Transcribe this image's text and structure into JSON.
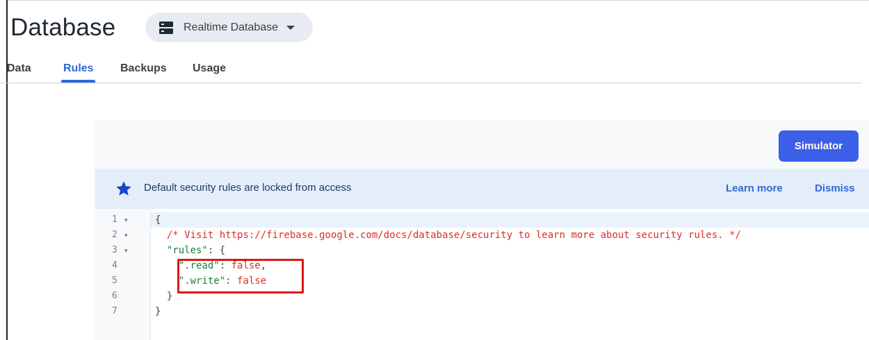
{
  "header": {
    "title": "Database",
    "db_selector": {
      "icon": "database-server-icon",
      "label": "Realtime Database"
    }
  },
  "tabs": [
    {
      "label": "Data",
      "active": false
    },
    {
      "label": "Rules",
      "active": true
    },
    {
      "label": "Backups",
      "active": false
    },
    {
      "label": "Usage",
      "active": false
    }
  ],
  "toolbar": {
    "simulator_label": "Simulator"
  },
  "banner": {
    "icon": "star-icon",
    "text": "Default security rules are locked from access",
    "learn_more_label": "Learn more",
    "dismiss_label": "Dismiss"
  },
  "editor": {
    "line_numbers": [
      "1",
      "2",
      "3",
      "4",
      "5",
      "6",
      "7"
    ],
    "fold_markers": [
      "▾",
      "▾",
      "▾",
      "",
      "",
      "",
      ""
    ],
    "lines": [
      [
        {
          "t": "{",
          "c": "punc"
        }
      ],
      [
        {
          "t": "  ",
          "c": "punc"
        },
        {
          "t": "/* Visit https://firebase.google.com/docs/database/security to learn more about security rules. */",
          "c": "comment"
        }
      ],
      [
        {
          "t": "  ",
          "c": "punc"
        },
        {
          "t": "\"rules\"",
          "c": "key"
        },
        {
          "t": ": {",
          "c": "punc"
        }
      ],
      [
        {
          "t": "    ",
          "c": "punc"
        },
        {
          "t": "\".read\"",
          "c": "key"
        },
        {
          "t": ": ",
          "c": "punc"
        },
        {
          "t": "false",
          "c": "val"
        },
        {
          "t": ",",
          "c": "punc"
        }
      ],
      [
        {
          "t": "    ",
          "c": "punc"
        },
        {
          "t": "\".write\"",
          "c": "key"
        },
        {
          "t": ": ",
          "c": "punc"
        },
        {
          "t": "false",
          "c": "val"
        }
      ],
      [
        {
          "t": "  }",
          "c": "punc"
        }
      ],
      [
        {
          "t": "}",
          "c": "punc"
        }
      ]
    ]
  },
  "colors": {
    "accent": "#3367d6",
    "simulator_bg": "#3b5fe6",
    "banner_bg": "#e4edfa",
    "highlight_border": "#e01414",
    "comment": "#d93025",
    "key": "#188038"
  }
}
